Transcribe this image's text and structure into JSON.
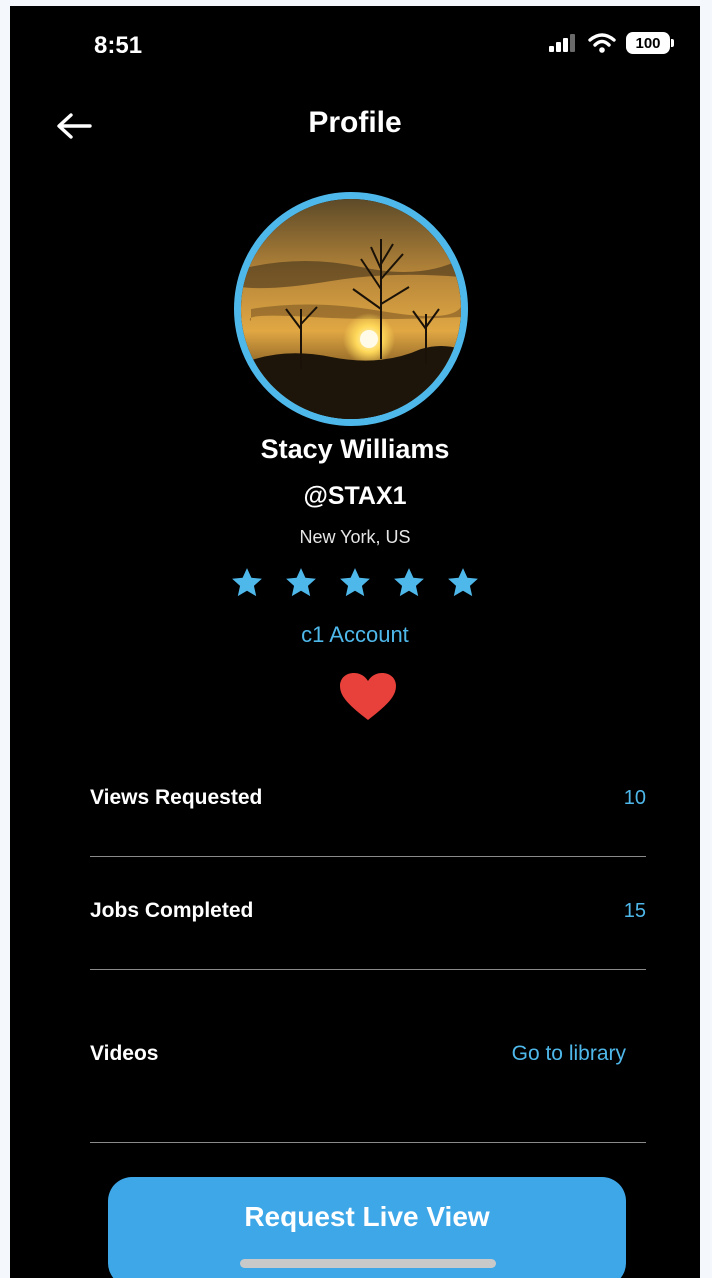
{
  "status_bar": {
    "time": "8:51",
    "battery": "100",
    "icons": [
      "cellular-signal-icon",
      "wifi-icon",
      "battery-icon"
    ]
  },
  "header": {
    "title": "Profile",
    "back_icon": "arrow-left-icon"
  },
  "profile": {
    "name": "Stacy Williams",
    "handle": "@STAX1",
    "location": "New York, US",
    "rating": 5,
    "rating_max": 5,
    "account_type": "c1 Account",
    "favorite_icon": "heart-icon"
  },
  "stats": [
    {
      "label": "Views Requested",
      "value": "10"
    },
    {
      "label": "Jobs Completed",
      "value": "15"
    },
    {
      "label": "Videos",
      "value": "Go to library"
    }
  ],
  "cta": {
    "label": "Request Live View"
  },
  "colors": {
    "accent": "#4fb8ea",
    "button": "#3ea7e8",
    "heart": "#e8403a",
    "background": "#000000"
  }
}
